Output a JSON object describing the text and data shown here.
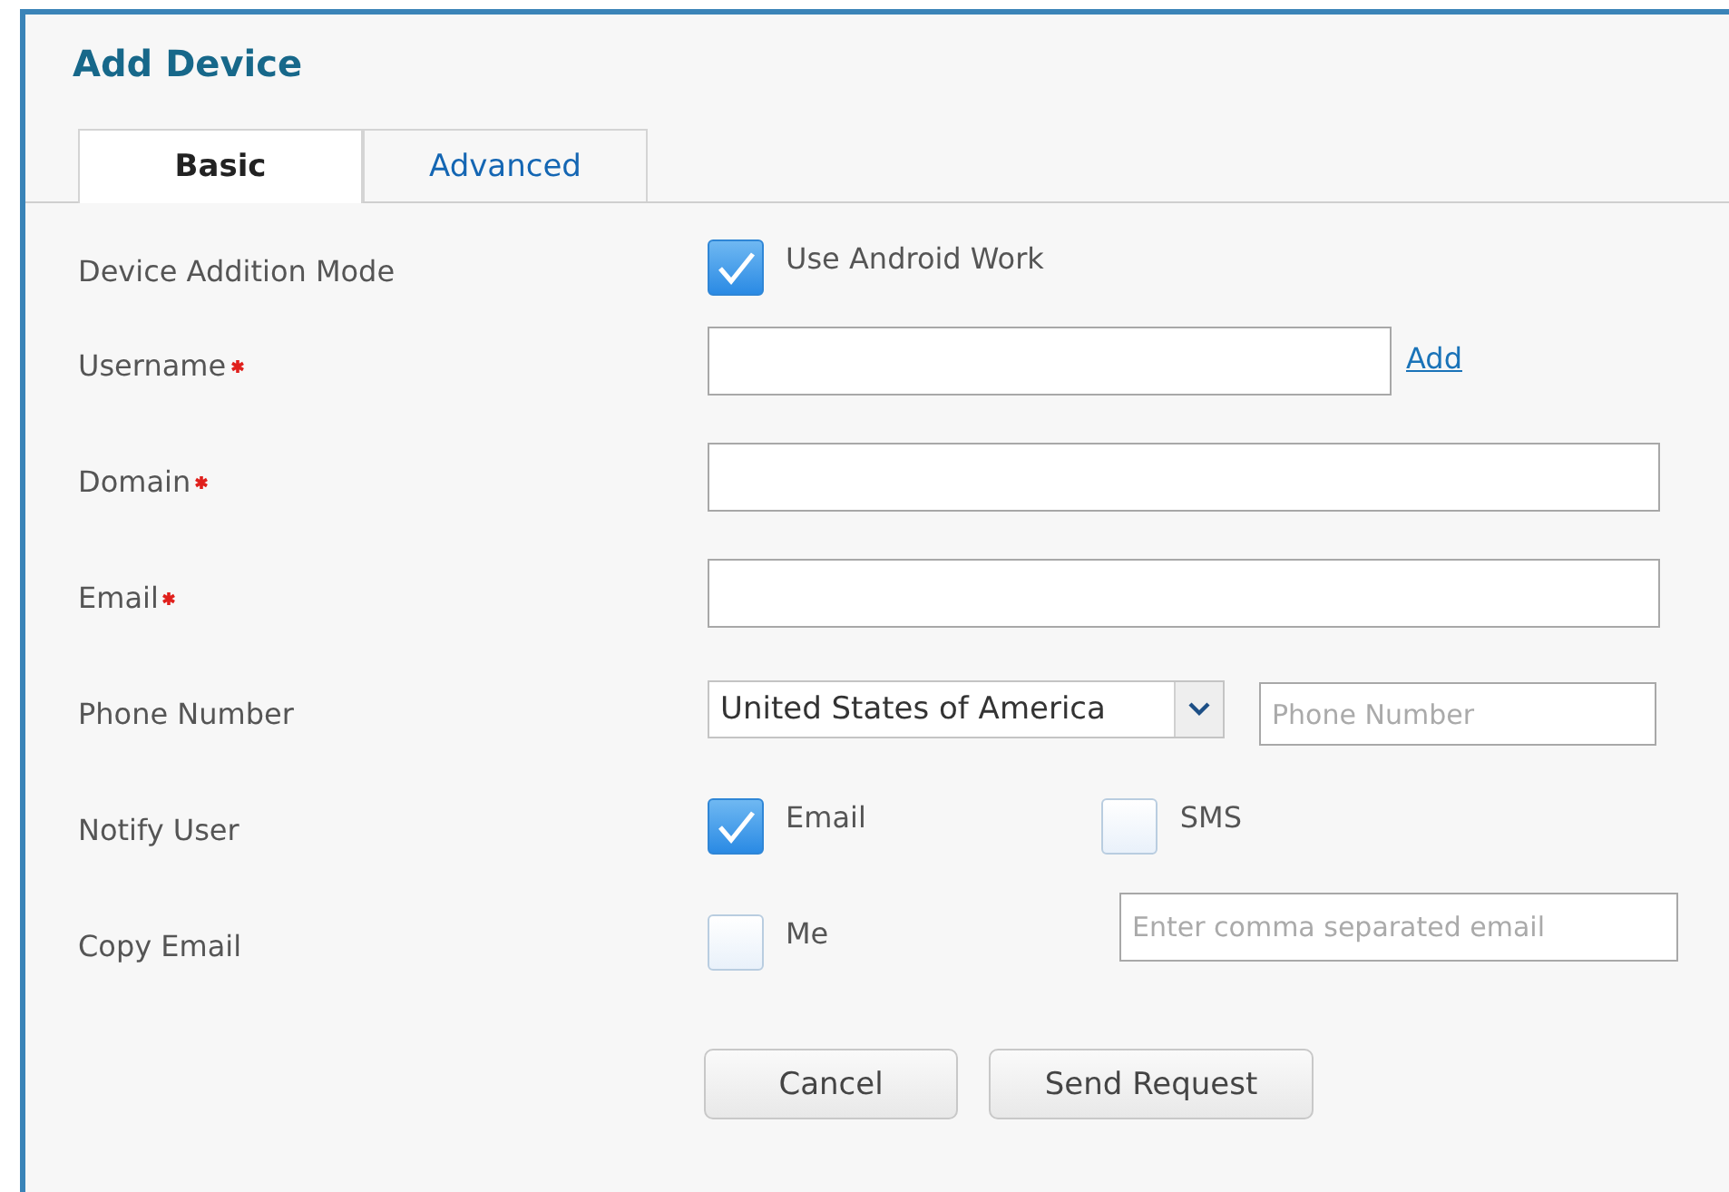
{
  "dialog": {
    "title": "Add Device"
  },
  "tabs": [
    {
      "label": "Basic",
      "selected": true
    },
    {
      "label": "Advanced",
      "selected": false
    }
  ],
  "rows": [
    {
      "kind": "check",
      "label": "Device Addition Mode",
      "required": false,
      "options": [
        {
          "label": "Use Android Work",
          "checked": true
        }
      ]
    },
    {
      "kind": "text",
      "label": "Username",
      "required": true,
      "link": "Add"
    },
    {
      "kind": "text",
      "label": "Domain",
      "required": true
    },
    {
      "kind": "text",
      "label": "Email",
      "required": true
    },
    {
      "kind": "phone",
      "label": "Phone Number",
      "required": false,
      "country": "United States of America",
      "placeholder": "Phone Number"
    },
    {
      "kind": "check",
      "label": "Notify User",
      "required": false,
      "options": [
        {
          "label": "Email",
          "checked": true
        },
        {
          "label": "SMS",
          "checked": false
        }
      ]
    },
    {
      "kind": "copy",
      "label": "Copy Email",
      "required": false,
      "options": [
        {
          "label": "Me",
          "checked": false
        }
      ],
      "placeholder": "Enter comma separated email"
    }
  ],
  "buttons": [
    {
      "label": "Cancel"
    },
    {
      "label": "Send Request"
    }
  ]
}
